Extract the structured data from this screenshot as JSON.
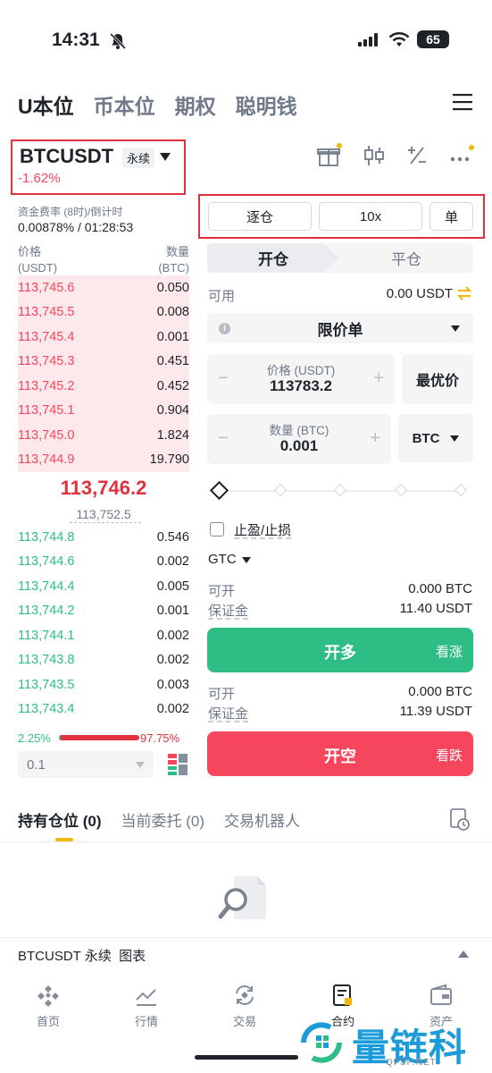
{
  "status": {
    "time": "14:31",
    "battery": "65"
  },
  "top_tabs": [
    "U本位",
    "币本位",
    "期权",
    "聪明钱"
  ],
  "symbol": {
    "name": "BTCUSDT",
    "badge": "永续",
    "change": "-1.62%"
  },
  "funding": {
    "label": "资金费率 (8时)/倒计时",
    "value": "0.00878% / 01:28:53"
  },
  "orderbook": {
    "price_label": "价格",
    "price_unit": "(USDT)",
    "qty_label": "数量",
    "qty_unit": "(BTC)",
    "asks": [
      {
        "price": "113,745.6",
        "qty": "0.050"
      },
      {
        "price": "113,745.5",
        "qty": "0.008"
      },
      {
        "price": "113,745.4",
        "qty": "0.001"
      },
      {
        "price": "113,745.3",
        "qty": "0.451"
      },
      {
        "price": "113,745.2",
        "qty": "0.452"
      },
      {
        "price": "113,745.1",
        "qty": "0.904"
      },
      {
        "price": "113,745.0",
        "qty": "1.824"
      },
      {
        "price": "113,744.9",
        "qty": "19.790"
      }
    ],
    "last_price": "113,746.2",
    "mark_price": "113,752.5",
    "bids": [
      {
        "price": "113,744.8",
        "qty": "0.546"
      },
      {
        "price": "113,744.6",
        "qty": "0.002"
      },
      {
        "price": "113,744.4",
        "qty": "0.005"
      },
      {
        "price": "113,744.2",
        "qty": "0.001"
      },
      {
        "price": "113,744.1",
        "qty": "0.002"
      },
      {
        "price": "113,743.8",
        "qty": "0.002"
      },
      {
        "price": "113,743.5",
        "qty": "0.003"
      },
      {
        "price": "113,743.4",
        "qty": "0.002"
      }
    ],
    "buy_ratio": "2.25%",
    "sell_ratio": "97.75%",
    "buy_ratio_value": 2.25,
    "depth": "0.1"
  },
  "order": {
    "margin_mode": "逐仓",
    "leverage": "10x",
    "position_mode": "单",
    "tab_open": "开仓",
    "tab_close": "平仓",
    "available_label": "可用",
    "available_value": "0.00 USDT",
    "order_type": "限价单",
    "price_label": "价格 (USDT)",
    "price_value": "113783.2",
    "best_price": "最优价",
    "qty_label": "数量 (BTC)",
    "qty_value": "0.001",
    "qty_unit": "BTC",
    "tpsl": "止盈/止损",
    "tif": "GTC",
    "long": {
      "open_label": "可开",
      "open_value": "0.000 BTC",
      "margin_label": "保证金",
      "margin_value": "11.40 USDT",
      "button": "开多",
      "sub": "看涨"
    },
    "short": {
      "open_label": "可开",
      "open_value": "0.000 BTC",
      "margin_label": "保证金",
      "margin_value": "11.39 USDT",
      "button": "开空",
      "sub": "看跌"
    }
  },
  "bottom_tabs": [
    "持有仓位 (0)",
    "当前委托 (0)",
    "交易机器人"
  ],
  "chart_strip": "BTCUSDT 永续  图表",
  "nav": [
    "首页",
    "行情",
    "交易",
    "合约",
    "资产"
  ],
  "watermark": {
    "text": "量链科技",
    "sub": "QFSP.NET"
  },
  "colors": {
    "green": "#2ebd85",
    "red": "#f6465d",
    "accent": "#f0b90b"
  }
}
